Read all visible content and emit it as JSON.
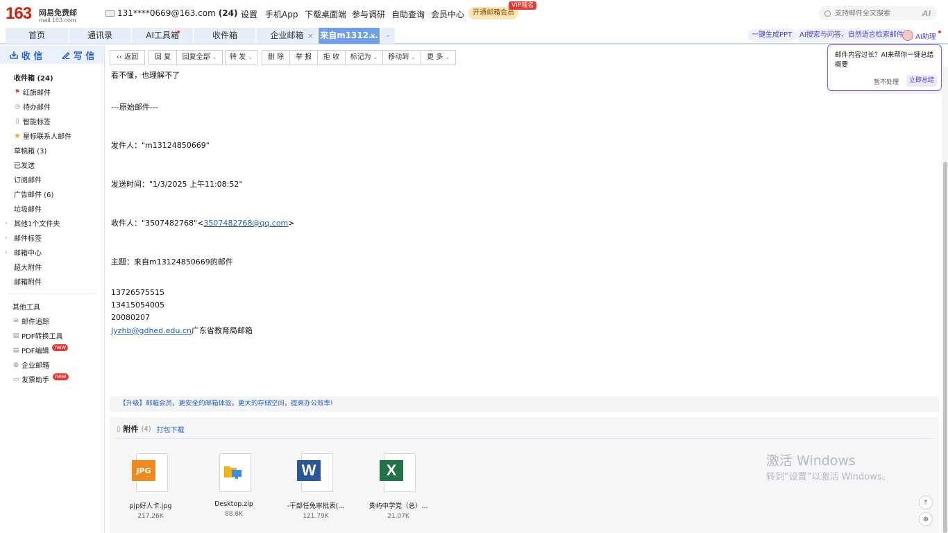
{
  "header": {
    "logo_number": "163",
    "logo_text": "网易免费邮",
    "logo_url": "mail.163.com",
    "account": "131****0669@163.com",
    "account_count": "(24)",
    "nav": [
      "设置",
      "手机App",
      "下载桌面端",
      "参与调研",
      "自助查询",
      "会员中心"
    ],
    "vip_button": "开通邮箱会员",
    "vip_badge": "VIP域名",
    "search_placeholder": "支持邮件全文搜索",
    "search_ai": "AI"
  },
  "tabs": [
    {
      "label": "首页"
    },
    {
      "label": "通讯录"
    },
    {
      "label": "AI工具箱"
    },
    {
      "label": "收件箱"
    },
    {
      "label": "企业邮箱"
    },
    {
      "label": "来自m1312..."
    }
  ],
  "tab_pills": [
    "一键生成PPT",
    "AI搜索与问答，自然语言检索邮件"
  ],
  "ai_assistant": "AI助理",
  "sidebar": {
    "receive": "收 信",
    "write": "写 信",
    "items": [
      {
        "label": "收件箱 (24)"
      },
      {
        "label": "红旗邮件"
      },
      {
        "label": "待办邮件"
      },
      {
        "label": "智能标签"
      },
      {
        "label": "星标联系人邮件"
      },
      {
        "label": "草稿箱 (3)"
      },
      {
        "label": "已发送"
      },
      {
        "label": "订阅邮件"
      },
      {
        "label": "广告邮件 (6)"
      },
      {
        "label": "垃圾邮件"
      },
      {
        "label": "其他1个文件夹"
      },
      {
        "label": "邮件标签"
      },
      {
        "label": "邮箱中心"
      },
      {
        "label": "超大附件"
      },
      {
        "label": "邮箱附件"
      }
    ],
    "tools_title": "其他工具",
    "tools": [
      {
        "label": "邮件追踪"
      },
      {
        "label": "PDF转换工具"
      },
      {
        "label": "PDF编辑"
      },
      {
        "label": "企业邮箱"
      },
      {
        "label": "发票助手"
      }
    ],
    "new_tag": "new"
  },
  "toolbar": {
    "back": "返回",
    "reply": "回 复",
    "reply_all": "回复全部",
    "forward": "转 发",
    "delete": "删 除",
    "report": "举 报",
    "reject": "拒 收",
    "mark": "标记为",
    "move": "移动到",
    "more": "更 多"
  },
  "ai_popup": {
    "message": "邮件内容过长？AI来帮你一键总结概要",
    "later": "暂不处理",
    "now": "立即总结"
  },
  "mail": {
    "line1": "看不懂，也理解不了",
    "original": "---原始邮件---",
    "from": "发件人：\"m13124850669\"",
    "time": "发送时间：\"1/3/2025 上午11:08:52\"",
    "to_prefix": "收件人：\"3507482768\"<",
    "to_link": "3507482768@qq.com",
    "to_suffix": ">",
    "subject": "主题：来自m13124850669的邮件",
    "num1": "13726575515",
    "num2": "13415054005",
    "num3": "20080207",
    "email_link": "Jyzhb@gdhed.edu.cn",
    "email_desc": "广东省教育局邮箱"
  },
  "upgrade_banner": "【升级】邮箱会员，更安全的邮箱体验，更大的存储空间，提高办公效率!",
  "attachments": {
    "label": "附件",
    "count": "(4)",
    "download_all": "打包下载",
    "files": [
      {
        "name": "pjp好人卡.jpg",
        "size": "217.26K",
        "type": "JPG",
        "color": "#f08a1c"
      },
      {
        "name": "Desktop.zip",
        "size": "88.8K",
        "type": "zip",
        "color": "#f5b400"
      },
      {
        "name": "-干部任免审批表(...",
        "size": "121.79K",
        "type": "W",
        "color": "#2b579a"
      },
      {
        "name": "贵屿中学党（总）...",
        "size": "21.07K",
        "type": "X",
        "color": "#217346"
      }
    ]
  },
  "watermark": {
    "line1": "激活 Windows",
    "line2": "转到“设置”以激活 Windows。"
  }
}
